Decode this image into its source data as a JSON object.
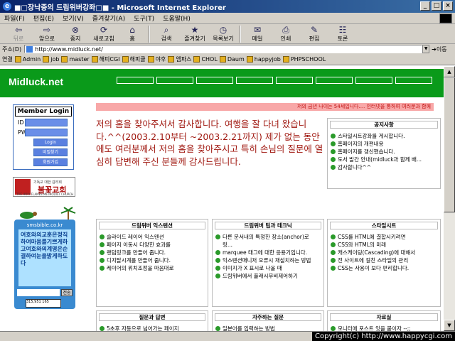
{
  "window": {
    "title": "■□장낙중의 드림위버강좌□■ - Microsoft Internet Explorer",
    "controls": [
      "_",
      "□",
      "×"
    ]
  },
  "menu": [
    "파일(F)",
    "편집(E)",
    "보기(V)",
    "즐겨찾기(A)",
    "도구(T)",
    "도움말(H)"
  ],
  "toolbar": {
    "back": "뒤로",
    "forward": "앞으로",
    "stop": "중지",
    "refresh": "새로고침",
    "home": "홈",
    "search": "검색",
    "favorites": "즐겨찾기",
    "history": "목록보기",
    "mail": "메일",
    "print": "인쇄",
    "edit": "편집",
    "discuss": "토론"
  },
  "address": {
    "label": "주소(D)",
    "url": "http://www.midluck.net/",
    "go": "이동"
  },
  "links": {
    "label": "연결",
    "items": [
      "Admin",
      "job",
      "master",
      "해피CGI",
      "해피클",
      "야후",
      "엠파스",
      "CHOL",
      "Daum",
      "happyjob",
      "PHPSCHOOL"
    ]
  },
  "site": {
    "logo": "Midluck.net",
    "nav": [
      "",
      "",
      "",
      "",
      "",
      "",
      "",
      ""
    ],
    "notice": "저의 금년 나이는 54세입니다.... 인터넷을 통하여 여러분과 함께",
    "welcome": "저의 홈을 찾아주셔서 감사합니다. 여행을 잘 다녀 왔습니다.^^(2003.2.10부터 ~2003.2.21까지) 제가 없는 동안에도 여러분께서 저의 홈을 찾아주시고 특히 손님의 질문에 열심히 답변해 주신 분들께 감사드립니다."
  },
  "login": {
    "title": "Member Login",
    "id_label": "ID",
    "pw_label": "PW",
    "btn_login": "Login",
    "btn_find": "비밀찾기",
    "btn_join": "회원가입"
  },
  "church": {
    "top": "기독교 대한 감리회",
    "name": "불꽃교회",
    "sub": "THE HOLY FLAMES METHODIST CHURCH"
  },
  "sms": {
    "brand": "smsbible.co.kr",
    "message": "여호와의교훈은정직하여마음를기쁘게하고여호와의계명은순결하여눈을밝게하도다",
    "send": "전송",
    "counter": "315,951 165"
  },
  "panels": {
    "notice": {
      "title": "공지사항",
      "items": [
        "스타일시트강좌를 게시합니다.",
        "홈페이지의 개편내용",
        "홈페이지를 갱신했습니다.",
        "도서 발간 안내(midluck과 함께 배...",
        "감사합니다^^"
      ]
    },
    "dw_tech": {
      "title": "드림위버 익스텐션",
      "items": [
        "슬라이드 레이어 익스텐션",
        "페이지 이동시 다양한 효과를",
        "랜덤링크를 만들어 줍니다.",
        "디지탈시계를 만들어 줍니다.",
        "레이어의 위치조정을 마음대로"
      ]
    },
    "dw_tips": {
      "title": "드림위버 팁과 테크닉",
      "items": [
        "다른 문서내의 특정한 장소(anchor)로 링...",
        "marquee 태그에 대한 응용기입니다.",
        "익스텐션매니저 오류시 재설치하는 방법",
        "이미지가 X 표시로 나올 때",
        "드림위버에서 플래시무비제어하기"
      ]
    },
    "stylesheet": {
      "title": "스타일시트",
      "items": [
        "CSS를 HTML에 결합시키려면",
        "CSS와 HTML의 미래",
        "캐스케이딩(Cascading)에 대해서",
        "전 사이트에 걸친 스타일의 관리",
        "CSS는 사용이 보다 편리합니다."
      ]
    },
    "qna": {
      "title": "질문과 답변",
      "items": [
        "5초후 자동으로 넘어가는 페이지"
      ]
    },
    "faq": {
      "title": "자주하는 질문",
      "items": [
        "일본어를 입력하는 방법"
      ]
    },
    "data": {
      "title": "자료실",
      "items": [
        "모니터에 포스트 잇을 붙이자 --;;"
      ]
    }
  },
  "status": {
    "copyright": "Copyright(c) http://www.happycgi.com"
  },
  "colors": {
    "header_green": "#0a9a1a",
    "welcome_text": "#a01810",
    "login_blue": "#5a80e0"
  }
}
